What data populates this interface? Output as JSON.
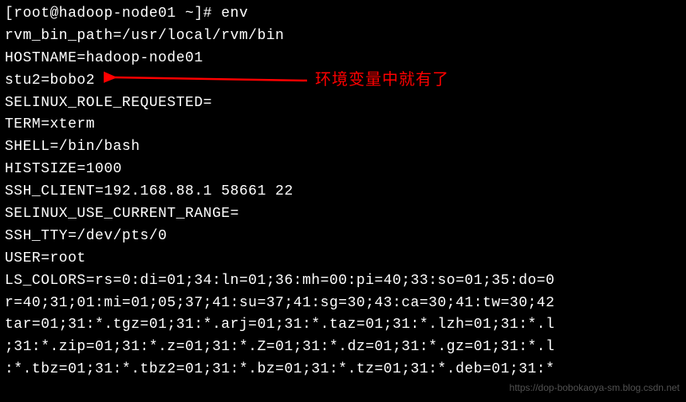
{
  "terminal": {
    "lines": [
      "[root@hadoop-node01 ~]# env",
      "rvm_bin_path=/usr/local/rvm/bin",
      "HOSTNAME=hadoop-node01",
      "stu2=bobo2",
      "SELINUX_ROLE_REQUESTED=",
      "TERM=xterm",
      "SHELL=/bin/bash",
      "HISTSIZE=1000",
      "SSH_CLIENT=192.168.88.1 58661 22",
      "SELINUX_USE_CURRENT_RANGE=",
      "SSH_TTY=/dev/pts/0",
      "USER=root",
      "LS_COLORS=rs=0:di=01;34:ln=01;36:mh=00:pi=40;33:so=01;35:do=0",
      "r=40;31;01:mi=01;05;37;41:su=37;41:sg=30;43:ca=30;41:tw=30;42",
      "tar=01;31:*.tgz=01;31:*.arj=01;31:*.taz=01;31:*.lzh=01;31:*.l",
      ";31:*.zip=01;31:*.z=01;31:*.Z=01;31:*.dz=01;31:*.gz=01;31:*.l",
      ":*.tbz=01;31:*.tbz2=01;31:*.bz=01;31:*.tz=01;31:*.deb=01;31:*"
    ]
  },
  "annotation": {
    "text": "环境变量中就有了",
    "arrow_color": "#ff0000"
  },
  "watermark": {
    "text": "https://dop-bobokaoya-sm.blog.csdn.net"
  }
}
